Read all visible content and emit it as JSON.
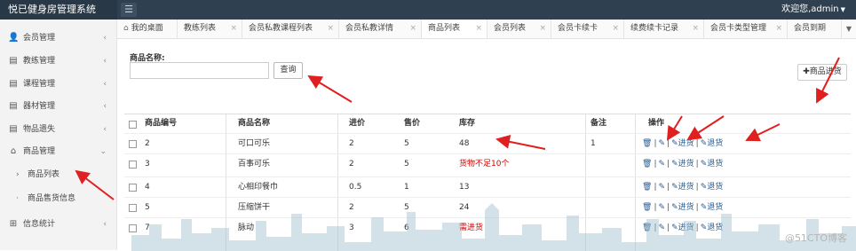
{
  "app": {
    "title": "悦已健身房管理系统",
    "welcome": "欢迎您,admin"
  },
  "sidebar": {
    "items": [
      {
        "label": "会员管理",
        "icon": "user-icon"
      },
      {
        "label": "教练管理",
        "icon": "document-icon"
      },
      {
        "label": "课程管理",
        "icon": "document-icon"
      },
      {
        "label": "器材管理",
        "icon": "document-icon"
      },
      {
        "label": "物品遗失",
        "icon": "document-icon"
      },
      {
        "label": "商品管理",
        "icon": "home-icon"
      }
    ],
    "sub_items": [
      {
        "label": "商品列表"
      },
      {
        "label": "商品售货信息"
      }
    ],
    "last_item": {
      "label": "信息统计",
      "icon": "grid-icon"
    }
  },
  "tabs": [
    {
      "label": "我的桌面"
    },
    {
      "label": "教练列表"
    },
    {
      "label": "会员私教课程列表"
    },
    {
      "label": "会员私教详情"
    },
    {
      "label": "商品列表"
    },
    {
      "label": "会员列表"
    },
    {
      "label": "会员卡续卡"
    },
    {
      "label": "续费续卡记录"
    },
    {
      "label": "会员卡类型管理"
    },
    {
      "label": "会员到期"
    }
  ],
  "search": {
    "label": "商品名称:",
    "value": "",
    "query_button": "查询"
  },
  "add_button": "✚商品进货",
  "table": {
    "headers": [
      "商品编号",
      "商品名称",
      "进价",
      "售价",
      "库存",
      "备注",
      "操作"
    ],
    "rows": [
      {
        "id": "2",
        "name": "可口可乐",
        "cost": "2",
        "price": "5",
        "stock": "48",
        "note": "1",
        "stock_alert": false
      },
      {
        "id": "3",
        "name": "百事可乐",
        "cost": "2",
        "price": "5",
        "stock": "货物不足10个",
        "note": "",
        "stock_alert": true
      },
      {
        "id": "4",
        "name": "心相印餐巾",
        "cost": "0.5",
        "price": "1",
        "stock": "13",
        "note": "",
        "stock_alert": false
      },
      {
        "id": "5",
        "name": "压缩饼干",
        "cost": "2",
        "price": "5",
        "stock": "24",
        "note": "",
        "stock_alert": false
      },
      {
        "id": "7",
        "name": "脉动",
        "cost": "3",
        "price": "6",
        "stock": "需进货",
        "note": "",
        "stock_alert": true
      }
    ],
    "actions": {
      "restock": "进货",
      "return": "退货"
    }
  },
  "watermark": "@51CTO博客",
  "colors": {
    "topbar": "#2f4050",
    "brand": "#293846",
    "link": "#2a5d93",
    "alert": "#d60000",
    "arrow": "#e02020"
  }
}
